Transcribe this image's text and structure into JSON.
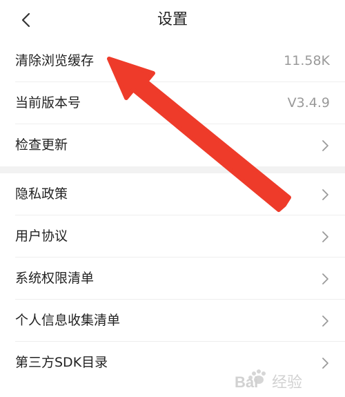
{
  "header": {
    "title": "设置",
    "back_icon": "chevron-left-icon"
  },
  "group1": [
    {
      "label": "清除浏览缓存",
      "value": "11.58K"
    },
    {
      "label": "当前版本号",
      "value": "V3.4.9"
    },
    {
      "label": "检查更新",
      "icon": "chevron-right-icon"
    }
  ],
  "group2": [
    {
      "label": "隐私政策",
      "icon": "chevron-right-icon"
    },
    {
      "label": "用户协议",
      "icon": "chevron-right-icon"
    },
    {
      "label": "系统权限清单",
      "icon": "chevron-right-icon"
    },
    {
      "label": "个人信息收集清单",
      "icon": "chevron-right-icon"
    },
    {
      "label": "第三方SDK目录",
      "icon": "chevron-right-icon"
    }
  ],
  "watermark": {
    "text": "Bai经验"
  },
  "colors": {
    "arrow": "#ee3b2a",
    "section_gap": "#f2f2f2",
    "value_text": "#999999"
  }
}
